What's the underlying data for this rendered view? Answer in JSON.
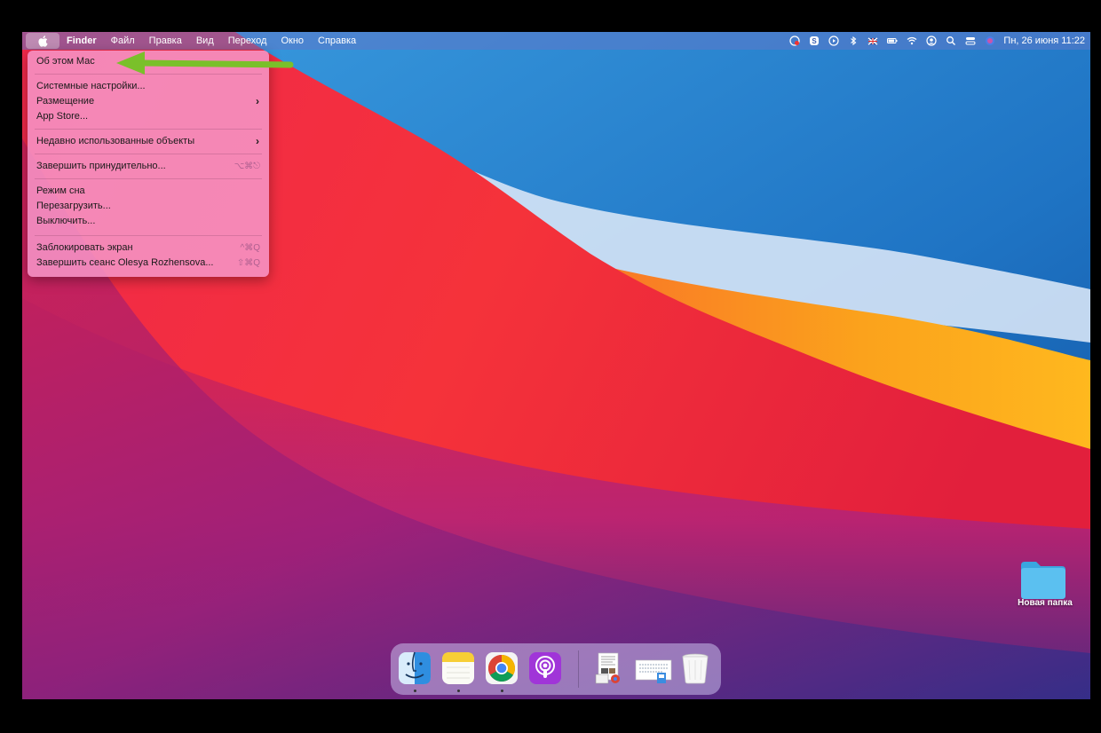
{
  "menubar": {
    "app_name": "Finder",
    "menus": [
      "Файл",
      "Правка",
      "Вид",
      "Переход",
      "Окно",
      "Справка"
    ],
    "clock": "Пн, 26 июня  11:22",
    "status_icons": [
      "screen-record-icon",
      "skype-icon",
      "play-icon",
      "bluetooth-icon",
      "flag-uk-icon",
      "battery-icon",
      "wifi-icon",
      "user-icon",
      "search-icon",
      "control-center-icon",
      "siri-icon"
    ]
  },
  "apple_menu": {
    "about": "Об этом Mac",
    "system_prefs": "Системные настройки...",
    "location": "Размещение",
    "app_store": "App Store...",
    "recent": "Недавно использованные объекты",
    "force_quit": "Завершить принудительно...",
    "force_quit_shortcut": "⌥⌘⎋",
    "sleep": "Режим сна",
    "restart": "Перезагрузить...",
    "shutdown": "Выключить...",
    "lock": "Заблокировать экран",
    "lock_shortcut": "^⌘Q",
    "logout": "Завершить сеанс Olesya Rozhensova...",
    "logout_shortcut": "⇧⌘Q"
  },
  "desktop": {
    "folder_label": "Новая папка"
  },
  "dock": {
    "apps": [
      "finder-icon",
      "notes-icon",
      "chrome-icon",
      "podcasts-icon",
      "downloads-stack-icon",
      "documents-stack-icon",
      "trash-icon"
    ]
  },
  "colors": {
    "menu_bg": "#f696c8",
    "arrow": "#7ac02a",
    "folder": "#5bc0f0"
  }
}
